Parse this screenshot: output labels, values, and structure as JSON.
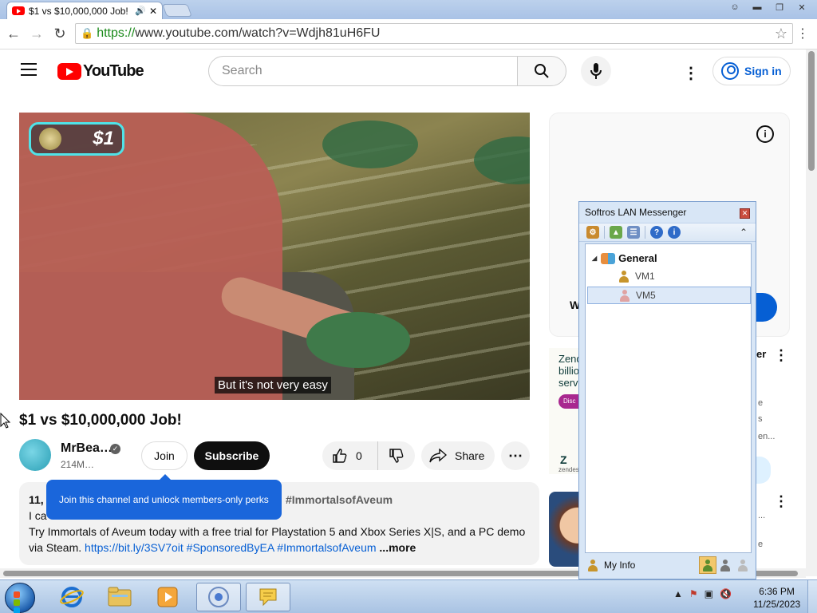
{
  "browser": {
    "tab_title": "$1 vs $10,000,000 Job!",
    "tab_close": "✕",
    "url_scheme": "https://",
    "url_rest": "www.youtube.com/watch?v=Wdjh81uH6FU"
  },
  "youtube": {
    "logo_text": "YouTube",
    "search_placeholder": "Search",
    "signin_label": "Sign in"
  },
  "video": {
    "badge_amount": "$1",
    "caption": "But it's not very easy",
    "title": "$1 vs $10,000,000 Job!"
  },
  "channel": {
    "name": "MrBea…",
    "subscribers": "214M…",
    "join_label": "Join",
    "subscribe_label": "Subscribe",
    "like_count": "0",
    "share_label": "Share"
  },
  "tooltip": {
    "text": "Join this channel and unlock members-only perks"
  },
  "description": {
    "meta_prefix": "11,",
    "meta_hashtag": "#ImmortalsofAveum",
    "line1_prefix": "I ca",
    "line2": "Try Immortals of Aveum today with a free trial for Playstation 5 and Xbox Series X|S, and a PC demo",
    "line3_prefix": "via Steam.",
    "link": "https://bit.ly/3SV7oit",
    "tag1": "#SponsoredByEA",
    "tag2": "#ImmortalsofAveum",
    "more": "...more"
  },
  "sidebar": {
    "ad_partial_left": "W",
    "ad_partial_button": "e",
    "zendesk_text": "Zend billio servi",
    "zendesk_pill": "Disc",
    "zendesk_logo": "Z",
    "zendesk_sub": "zendes",
    "side_item1": "er",
    "side_faint1": "e",
    "side_faint2": "s",
    "side_faint3": "en...",
    "side_faint4": "...",
    "side_faint5": "e"
  },
  "lan_messenger": {
    "title": "Softros LAN Messenger",
    "group_name": "General",
    "users": [
      "VM1",
      "VM5"
    ],
    "my_info": "My Info"
  },
  "taskbar": {
    "time": "6:36 PM",
    "date": "11/25/2023"
  },
  "colors": {
    "youtube_red": "#ff0000",
    "link_blue": "#065fd4",
    "tooltip_blue": "#1a66db"
  }
}
